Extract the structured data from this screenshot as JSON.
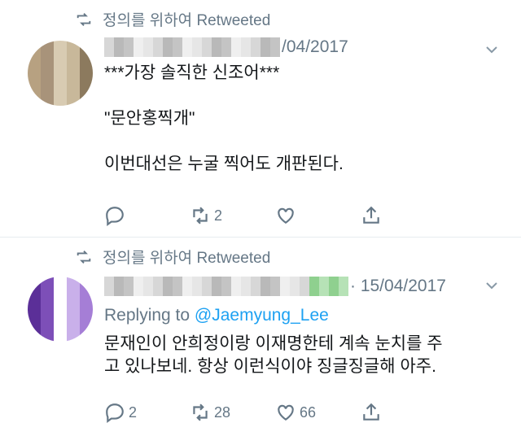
{
  "tweet1": {
    "retweet_label": "정의를 위하여 Retweeted",
    "date": "/04/2017",
    "lines": "***가장 솔직한 신조어***\n\n\"문안홍찍개\"\n\n이번대선은 누굴 찍어도 개판된다.",
    "reply_count": "",
    "retweet_count": "2",
    "like_count": ""
  },
  "tweet2": {
    "retweet_label": "정의를 위하여 Retweeted",
    "date": "· 15/04/2017",
    "replying_prefix": "Replying to ",
    "replying_handle": "@Jaemyung_Lee",
    "lines": "문재인이 안희정이랑 이재명한테 계속 눈치를 주\n고 있나보네. 항상 이런식이야 징글징글해 아주.",
    "reply_count": "2",
    "retweet_count": "28",
    "like_count": "66"
  },
  "colors": {
    "muted": "#657786",
    "link": "#1da1f2",
    "divider": "#e6ecf0",
    "avatar1": [
      "#c8b89a",
      "#a8937a",
      "#8c7a5e",
      "#d8cbb2",
      "#b7a181"
    ],
    "avatar2": [
      "#7d4fb8",
      "#a57ed6",
      "#ffffff",
      "#5b2f98",
      "#c9b0ea"
    ]
  },
  "icons": [
    "retweet-icon",
    "chevron-down-icon",
    "reply-icon",
    "retweet-icon",
    "like-icon",
    "share-icon"
  ]
}
